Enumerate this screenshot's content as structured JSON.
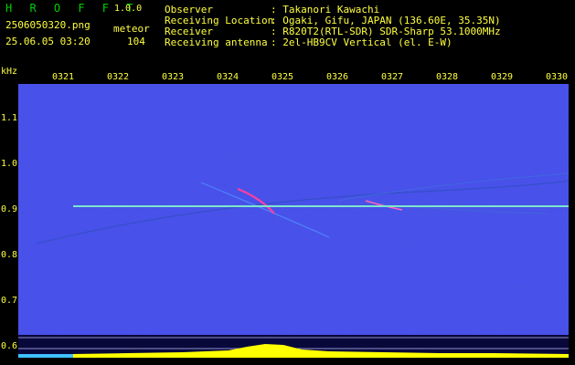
{
  "header": {
    "app_name": "H R O F F T",
    "version": "1.0.0",
    "filename": "2506050320.png",
    "datetime": "25.06.05 03:20",
    "count_label": "meteor",
    "count_value": "104",
    "fields": [
      {
        "label": "Observer",
        "value": ": Takanori Kawachi"
      },
      {
        "label": "Receiving Location",
        "value": ": Ogaki, Gifu, JAPAN (136.60E, 35.35N)"
      },
      {
        "label": "Receiver",
        "value": ": R820T2(RTL-SDR) SDR-Sharp 53.1000MHz"
      },
      {
        "label": "Receiving antenna",
        "value": ": 2el-HB9CV Vertical (el. E-W)"
      }
    ]
  },
  "axis": {
    "y_unit": "kHz",
    "y_ticks": [
      "1.1",
      "1.0",
      "0.9",
      "0.8",
      "0.7",
      "0.6"
    ],
    "x_ticks": [
      "0321",
      "0322",
      "0323",
      "0324",
      "0325",
      "0326",
      "0327",
      "0328",
      "0329",
      "0330"
    ]
  },
  "colors": {
    "background": "#000000",
    "header_text": "#ffff40",
    "logo": "#00d000",
    "spectrogram_noise": "#101050",
    "carrier": "#60e0c0",
    "meteor_echo": "#ff40a0",
    "level_bar": "#ffff00",
    "level_bar_low": "#40c0ff"
  }
}
